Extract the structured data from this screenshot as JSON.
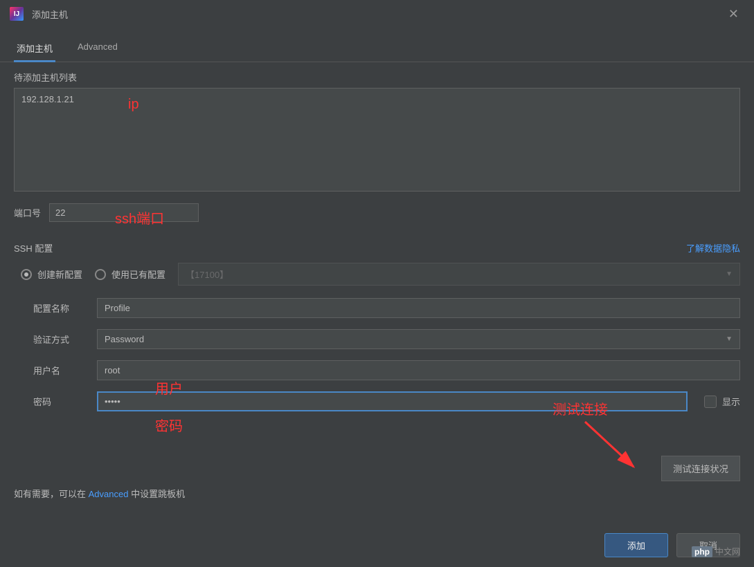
{
  "window": {
    "title": "添加主机"
  },
  "tabs": {
    "add_host": "添加主机",
    "advanced": "Advanced"
  },
  "hostlist": {
    "label": "待添加主机列表",
    "value": "192.128.1.21"
  },
  "port": {
    "label": "端口号",
    "value": "22"
  },
  "ssh": {
    "section_label": "SSH 配置",
    "privacy_link": "了解数据隐私",
    "radio_new": "创建新配置",
    "radio_existing": "使用已有配置",
    "existing_selected": "【17100】"
  },
  "form": {
    "profile_label": "配置名称",
    "profile_value": "Profile",
    "auth_label": "验证方式",
    "auth_value": "Password",
    "user_label": "用户名",
    "user_value": "root",
    "password_label": "密码",
    "password_value": "•••••",
    "show_label": "显示"
  },
  "actions": {
    "test_connection": "测试连接状况",
    "add": "添加",
    "cancel": "取消"
  },
  "hint": {
    "prefix": "如有需要，可以在 ",
    "link": "Advanced",
    "suffix": " 中设置跳板机"
  },
  "annotations": {
    "ip": "ip",
    "ssh_port": "ssh端口",
    "user": "用户",
    "password": "密码",
    "test": "测试连接"
  },
  "watermark": {
    "brand": "php",
    "text": "中文网"
  }
}
